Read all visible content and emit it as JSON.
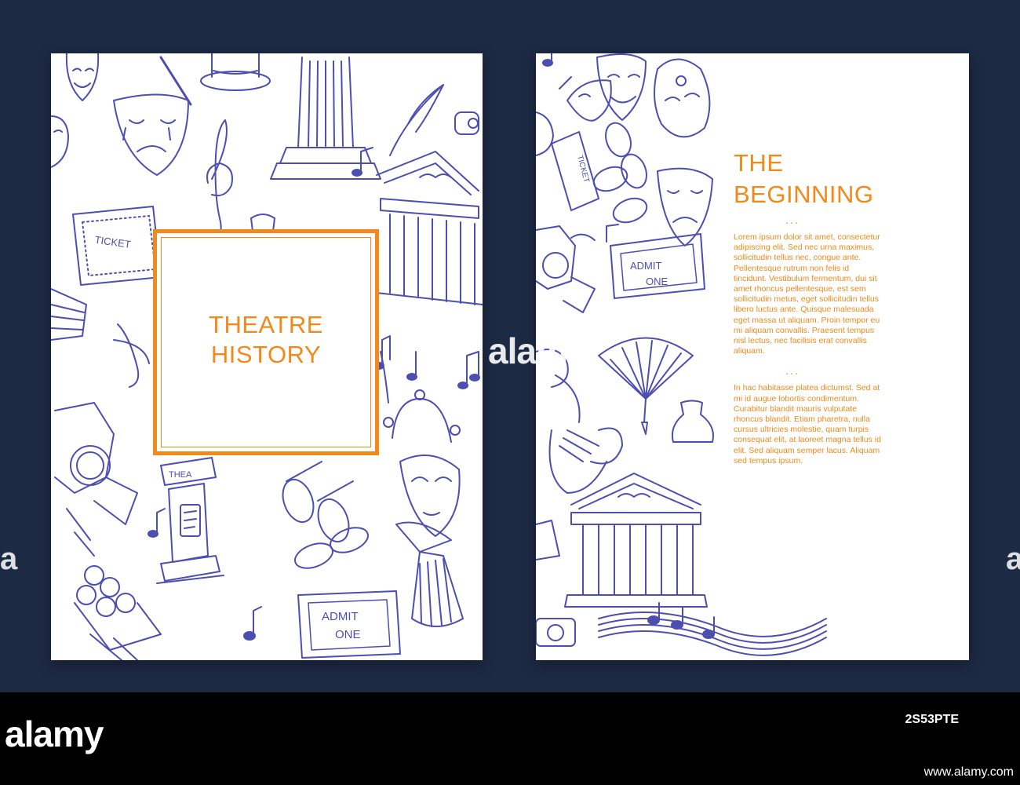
{
  "left_card": {
    "title_line1": "THEATRE",
    "title_line2": "HISTORY",
    "ticket_text": "TICKET",
    "admit_line1": "ADMIT",
    "admit_line2": "ONE",
    "column_text": "THEA"
  },
  "right_card": {
    "heading_line1": "THE",
    "heading_line2": "BEGINNING",
    "separator": "...",
    "paragraph1": "Lorem ipsum dolor sit amet, consectetur adipiscing elit. Sed nec urna maximus, sollicitudin tellus nec, congue ante. Pellentesque rutrum non felis id tincidunt. Vestibulum fermentum, dui sit amet rhoncus pellentesque, est sem sollicitudin metus, eget sollicitudin tellus libero luctus ante. Quisque malesuada eget massa ut aliquam. Proin tempor eu mi aliquam convallis. Praesent tempus nisl lectus, nec facilisis erat convallis aliquam.",
    "paragraph2": "In hac habitasse platea dictumst. Sed at mi id augue lobortis condimentum. Curabitur blandit mauris vulputate rhoncus blandit. Etiam pharetra, nulla cursus ultricies molestie, quam turpis consequat elit, at laoreet magna tellus id elit. Sed aliquam semper lacus. Aliquam sed tempus ipsum.",
    "ticket_text": "TICKET",
    "admit_line1": "ADMIT",
    "admit_line2": "ONE"
  },
  "watermark": {
    "center": "alamy",
    "left_edge": "a",
    "right_edge": "a"
  },
  "footer": {
    "logo": "alamy",
    "image_id": "2S53PTE",
    "url": "www.alamy.com"
  },
  "colors": {
    "background": "#1d2a44",
    "card": "#ffffff",
    "accent_orange": "#f28a1b",
    "doodle_blue": "#4c4fb0",
    "footer": "#000000"
  },
  "icons": [
    "theatre-mask-icon",
    "top-hat-icon",
    "column-icon",
    "quill-icon",
    "treble-clef-icon",
    "music-note-icon",
    "ticket-icon",
    "theatre-building-icon",
    "spotlight-icon",
    "binoculars-icon",
    "jester-mask-icon",
    "bouquet-icon",
    "fan-icon",
    "vase-icon",
    "lyre-icon"
  ]
}
